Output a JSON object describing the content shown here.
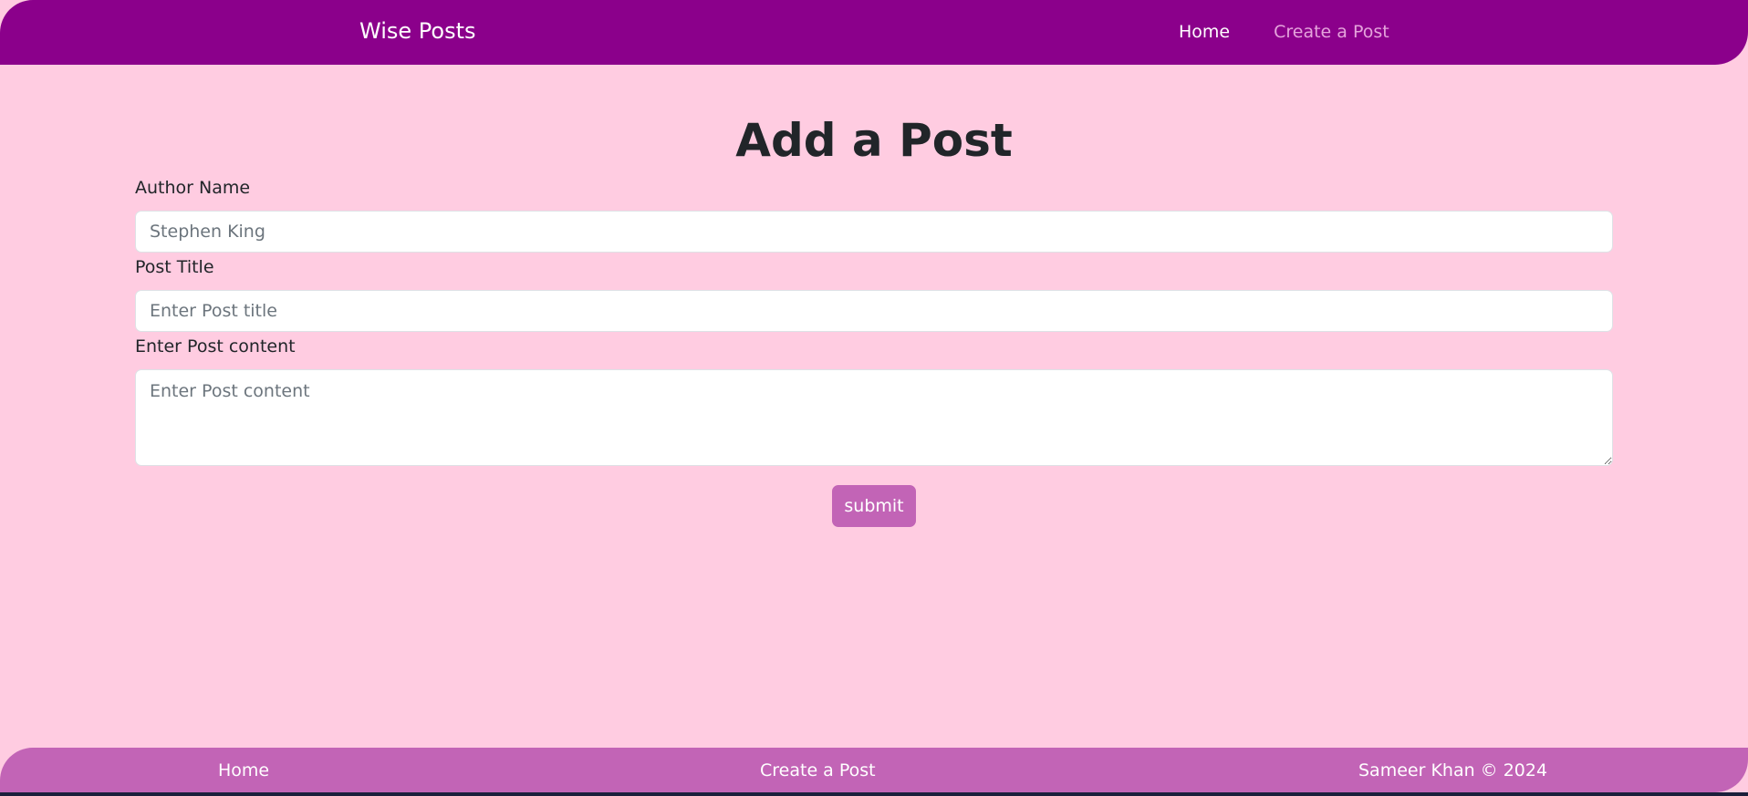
{
  "navbar": {
    "brand": "Wise Posts",
    "links": [
      {
        "label": "Home",
        "state": "active"
      },
      {
        "label": "Create a Post",
        "state": "muted"
      }
    ]
  },
  "form": {
    "heading": "Add a Post",
    "author": {
      "label": "Author Name",
      "placeholder": "Stephen King",
      "value": ""
    },
    "title": {
      "label": "Post Title",
      "placeholder": "Enter Post title",
      "value": ""
    },
    "content": {
      "label": "Enter Post content",
      "placeholder": "Enter Post content",
      "value": ""
    },
    "submit_label": "submit"
  },
  "footer": {
    "home": "Home",
    "create": "Create a Post",
    "copyright": "Sameer Khan © 2024"
  },
  "colors": {
    "page_background": "#ffcce1",
    "navbar_background": "#8b008b",
    "footer_background": "#c264b6",
    "submit_background": "#c264b6",
    "nav_active_text": "#ffffff",
    "nav_muted_text": "#e5a4dc"
  }
}
